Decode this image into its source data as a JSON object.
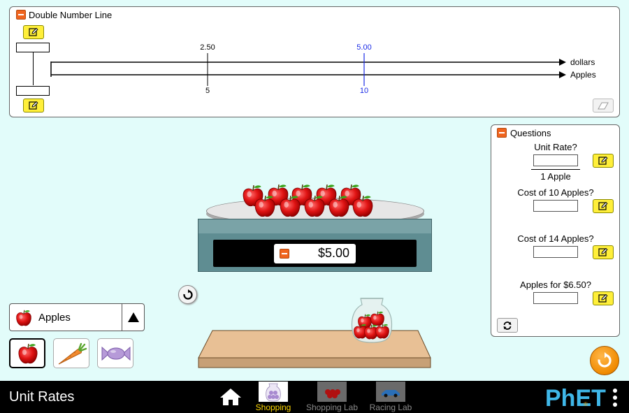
{
  "double_number_line": {
    "title": "Double Number Line",
    "top_label": "dollars",
    "bottom_label": "Apples",
    "marker1": {
      "top": "2.50",
      "bottom": "5"
    },
    "marker2": {
      "top": "5.00",
      "bottom": "10"
    },
    "marker2_color": "#1a2be6"
  },
  "scale": {
    "price": "$5.00",
    "apple_count": 10
  },
  "bag": {
    "apple_count": 5
  },
  "questions": {
    "title": "Questions",
    "q1_label": "Unit Rate?",
    "q1_denominator": "1 Apple",
    "q2_label": "Cost of 10 Apples?",
    "q3_label": "Cost of 14 Apples?",
    "q4_label": "Apples for $6.50?"
  },
  "item_selector": {
    "selected": "Apples",
    "options": [
      "apple-icon",
      "carrot-icon",
      "candy-icon"
    ]
  },
  "nav": {
    "app_title": "Unit Rates",
    "tabs": [
      {
        "label": "Shopping",
        "selected": true
      },
      {
        "label": "Shopping Lab",
        "selected": false
      },
      {
        "label": "Racing Lab",
        "selected": false
      }
    ],
    "brand": "PhET"
  },
  "colors": {
    "background": "#e2fcfa",
    "edit_button": "#ffef3a",
    "accent_orange": "#f0641e",
    "nav_selected": "#ffd800"
  }
}
